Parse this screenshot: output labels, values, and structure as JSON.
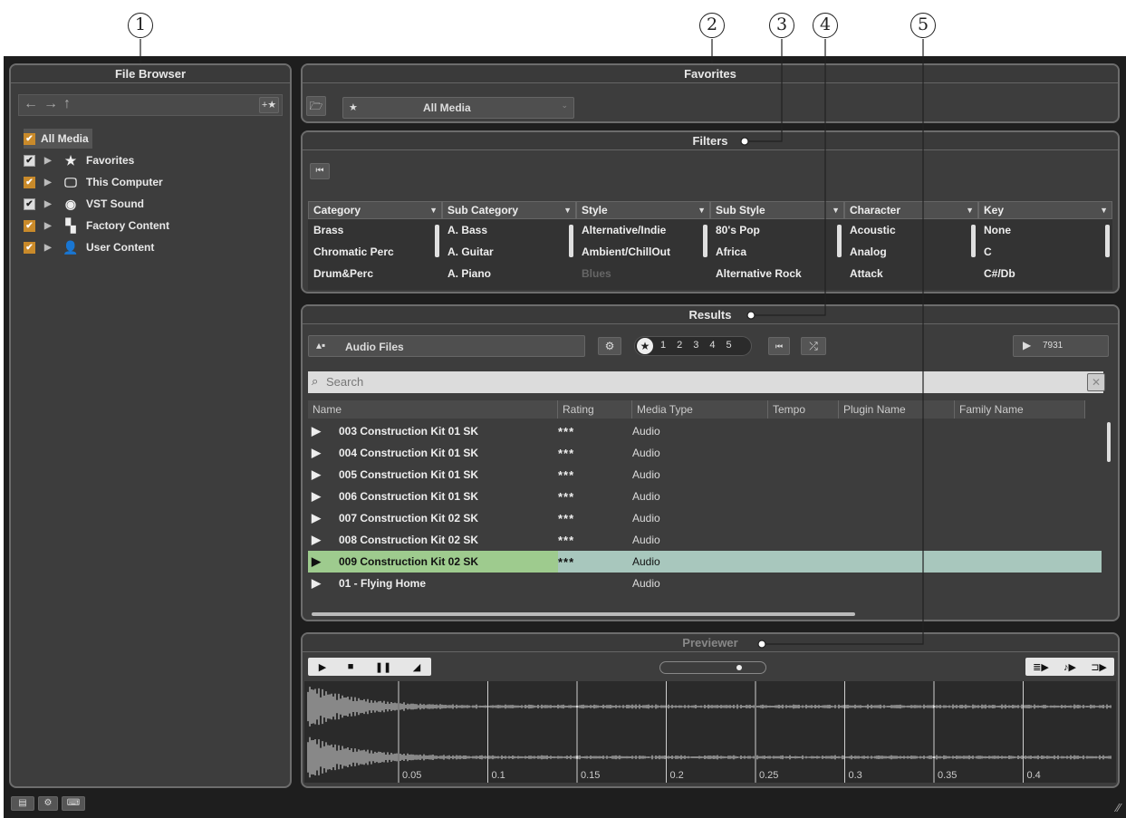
{
  "callouts": [
    "1",
    "2",
    "3",
    "4",
    "5"
  ],
  "file_browser": {
    "title": "File Browser",
    "tree": [
      {
        "label": "All Media",
        "icon": "",
        "checkbox": "orange"
      },
      {
        "label": "Favorites",
        "icon": "★",
        "checkbox": "white"
      },
      {
        "label": "This Computer",
        "icon": "🖵",
        "checkbox": "orange"
      },
      {
        "label": "VST Sound",
        "icon": "◉",
        "checkbox": "white"
      },
      {
        "label": "Factory Content",
        "icon": "▚",
        "checkbox": "orange"
      },
      {
        "label": "User Content",
        "icon": "👤",
        "checkbox": "orange"
      }
    ]
  },
  "favorites": {
    "title": "Favorites",
    "selected": "All Media",
    "star": "★"
  },
  "filters": {
    "title": "Filters",
    "columns": [
      {
        "header": "Category",
        "values": [
          "Brass",
          "Chromatic Perc",
          "Drum&Perc"
        ]
      },
      {
        "header": "Sub Category",
        "values": [
          "A. Bass",
          "A. Guitar",
          "A. Piano"
        ]
      },
      {
        "header": "Style",
        "values": [
          "Alternative/Indie",
          "Ambient/ChillOut",
          "Blues"
        ]
      },
      {
        "header": "Sub Style",
        "values": [
          "80's Pop",
          "Africa",
          "Alternative Rock"
        ]
      },
      {
        "header": "Character",
        "values": [
          "Acoustic",
          "Analog",
          "Attack"
        ]
      },
      {
        "header": "Key",
        "values": [
          "None",
          "C",
          "C#/Db"
        ]
      }
    ]
  },
  "results": {
    "title": "Results",
    "media_type": "Audio Files",
    "rating_filter": [
      "1",
      "2",
      "3",
      "4",
      "5"
    ],
    "count": "7931",
    "search_placeholder": "Search",
    "columns": [
      "Name",
      "Rating",
      "Media Type",
      "Tempo",
      "Plugin Name",
      "Family Name"
    ],
    "rows": [
      {
        "name": "003 Construction Kit 01 SK",
        "rating": "***",
        "type": "Audio"
      },
      {
        "name": "004 Construction Kit 01 SK",
        "rating": "***",
        "type": "Audio"
      },
      {
        "name": "005 Construction Kit 01 SK",
        "rating": "***",
        "type": "Audio"
      },
      {
        "name": "006 Construction Kit 01 SK",
        "rating": "***",
        "type": "Audio"
      },
      {
        "name": "007 Construction Kit 02 SK",
        "rating": "***",
        "type": "Audio"
      },
      {
        "name": "008 Construction Kit 02 SK",
        "rating": "***",
        "type": "Audio"
      },
      {
        "name": "009 Construction Kit 02 SK",
        "rating": "***",
        "type": "Audio",
        "selected": true
      },
      {
        "name": "01 - Flying Home",
        "rating": "",
        "type": "Audio"
      }
    ]
  },
  "previewer": {
    "title": "Previewer",
    "ticks": [
      "0.05",
      "0.1",
      "0.15",
      "0.2",
      "0.25",
      "0.3",
      "0.35",
      "0.4"
    ]
  }
}
